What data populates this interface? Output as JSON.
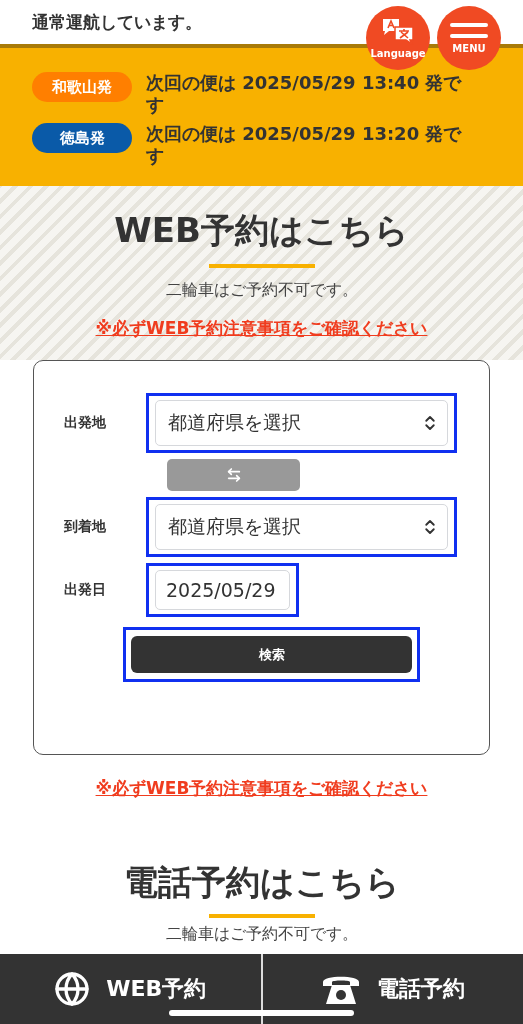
{
  "header": {
    "status": "通常運航しています。"
  },
  "top_buttons": [
    {
      "kind": "language",
      "label": "Language"
    },
    {
      "kind": "menu",
      "label": "MENU"
    }
  ],
  "departures": [
    {
      "port": "和歌山発",
      "color": "#ff7f00",
      "message": "次回の便は 2025/05/29 13:40 発です"
    },
    {
      "port": "徳島発",
      "color": "#0a5aa8",
      "message": "次回の便は 2025/05/29 13:20 発です"
    }
  ],
  "web_section": {
    "title": "WEB予約はこちら",
    "note": "二輪車はご予約不可です。",
    "notice_link": "※必ずWEB予約注意事項をご確認ください",
    "form": {
      "fields": [
        {
          "kind": "select",
          "label": "出発地",
          "value": "都道府県を選択"
        },
        {
          "kind": "swap"
        },
        {
          "kind": "select",
          "label": "到着地",
          "value": "都道府県を選択"
        },
        {
          "kind": "date",
          "label": "出発日",
          "value": "2025/05/29"
        }
      ],
      "search_button": "検索"
    },
    "bottom_link": "※必ずWEB予約注意事項をご確認ください"
  },
  "phone_section": {
    "title": "電話予約はこちら",
    "note": "二輪車はご予約不可です。"
  },
  "bottom_nav": [
    {
      "kind": "web",
      "label": "WEB予約"
    },
    {
      "kind": "phone",
      "label": "電話予約"
    }
  ]
}
